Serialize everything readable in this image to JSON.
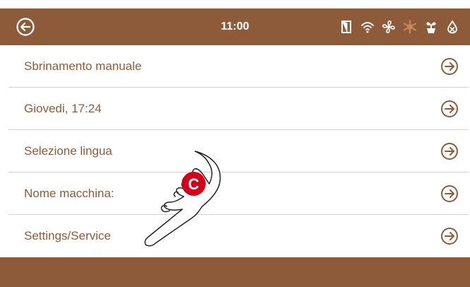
{
  "header": {
    "time": "11:00",
    "back_icon": "circle-arrow-left-icon",
    "status_icons": [
      "door-icon",
      "wifi-icon",
      "fan-icon",
      "defrost-snowflake-icon",
      "plant-icon",
      "drop-icon"
    ]
  },
  "menu": {
    "items": [
      {
        "label": "Sbrinamento manuale",
        "icon": "circle-arrow-right-icon"
      },
      {
        "label": "Giovedi, 17:24",
        "icon": "circle-arrow-right-icon"
      },
      {
        "label": "Selezione lingua",
        "icon": "circle-arrow-right-icon"
      },
      {
        "label": "Nome macchina:",
        "icon": "circle-arrow-right-icon"
      },
      {
        "label": "Settings/Service",
        "icon": "circle-arrow-right-icon"
      }
    ]
  },
  "overlay": {
    "badge": "C",
    "icon": "pointing-hand-icon"
  },
  "colors": {
    "brand": "#8e5b3a",
    "badge": "#d3001a",
    "divider": "#d7d0c8",
    "status_inactive": "#c9845a"
  }
}
